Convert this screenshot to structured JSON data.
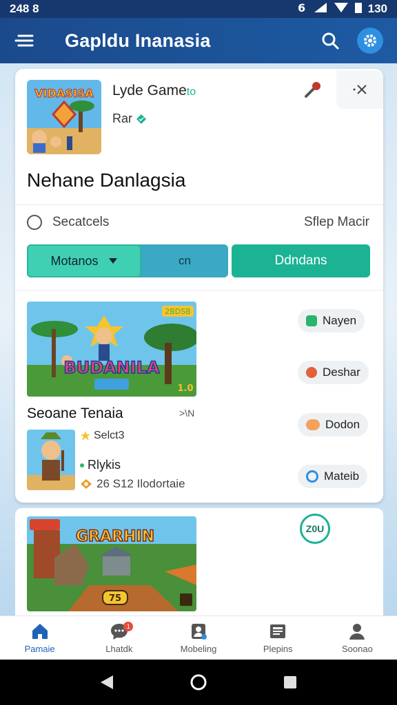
{
  "status": {
    "time": "248 8",
    "right": "130"
  },
  "app_bar": {
    "title": "Gapldu Inanasia"
  },
  "card": {
    "game_name": "Lyde Game",
    "game_name_suffix": "to",
    "game_sub": "Rar",
    "headline": "Nehane Danlagsia",
    "thumb_text": "VIDASISA",
    "search_label": "Secatcels",
    "search_right": "Sflep Macir",
    "dropdown_label": "Motanos",
    "mid_label": "cn",
    "green_button": "Ddndans",
    "banner1_title_text": "BUDANILA",
    "banner1_badge": "2BDSB",
    "banner1_corner": "1.0",
    "banner_title": "Seoane Tenaia",
    "banner_meta": ">\\N",
    "rating_text": "Selct3",
    "player_text": "Rlykis",
    "stats_text": "26 S12 Ilodortaie"
  },
  "chips": [
    {
      "label": "Nayen",
      "color": "#2db36b"
    },
    {
      "label": "Deshar",
      "color": "#e0613a"
    },
    {
      "label": "Dodon",
      "color": "#f3a15c"
    },
    {
      "label": "Mateib",
      "color": "#2f8fe0"
    }
  ],
  "second_card": {
    "banner_text": "GRARHIN",
    "badge": "Z0U",
    "corner": "75"
  },
  "bottom_nav": [
    {
      "label": "Pamaie",
      "icon": "home-icon"
    },
    {
      "label": "Lhatdk",
      "icon": "chat-icon"
    },
    {
      "label": "Mobeling",
      "icon": "person-card-icon"
    },
    {
      "label": "Plepins",
      "icon": "news-icon"
    },
    {
      "label": "Soonao",
      "icon": "profile-icon"
    }
  ],
  "notif_count": "1",
  "colors": {
    "appbar": "#1b4a8c",
    "teal": "#3fd0b3",
    "green": "#1bb394",
    "accent": "#2f8fe0"
  }
}
